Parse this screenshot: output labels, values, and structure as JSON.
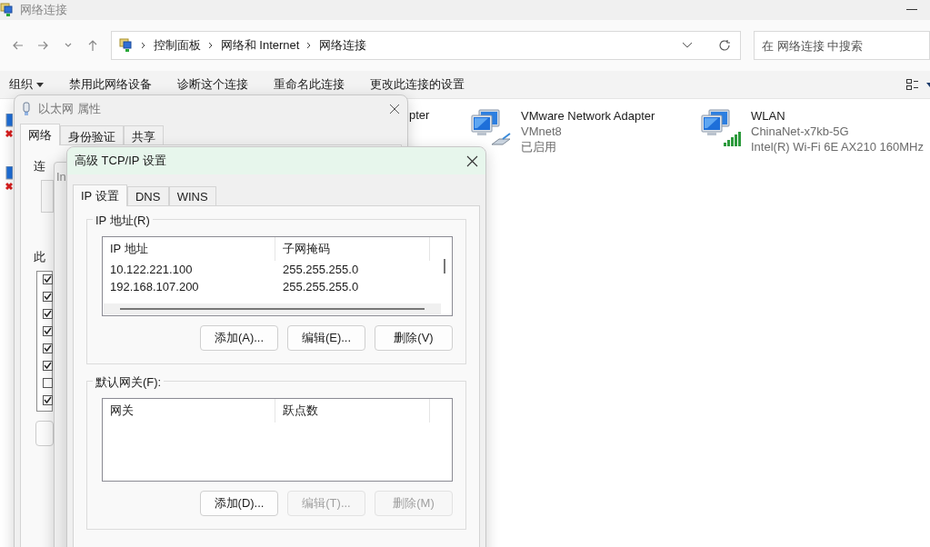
{
  "explorer": {
    "title": "网络连接",
    "breadcrumb": [
      "控制面板",
      "网络和 Internet",
      "网络连接"
    ],
    "search": {
      "placeholder": "在 网络连接 中搜索"
    },
    "toolbar": [
      {
        "label": "组织",
        "kind": "menu"
      },
      {
        "label": "禁用此网络设备",
        "kind": "command"
      },
      {
        "label": "诊断这个连接",
        "kind": "command"
      },
      {
        "label": "重命名此连接",
        "kind": "command"
      },
      {
        "label": "更改此连接的设置",
        "kind": "command"
      }
    ],
    "hidden_adapter_fragment": "pter",
    "adapters": [
      {
        "kind": "wired",
        "name": "VMware Network Adapter",
        "lines": [
          "VMnet8",
          "已启用"
        ]
      },
      {
        "kind": "wireless",
        "name": "WLAN",
        "lines": [
          "ChinaNet-x7kb-5G",
          "Intel(R) Wi-Fi 6E AX210 160MHz"
        ]
      }
    ]
  },
  "properties_dialog": {
    "title": "以太网 属性",
    "tabs": [
      {
        "label": "网络",
        "selected": true
      },
      {
        "label": "身份验证",
        "selected": false
      },
      {
        "label": "共享",
        "selected": false
      }
    ],
    "connect_label_fragment": "连",
    "items_label_fragment": "此",
    "components": [
      {
        "checked": true
      },
      {
        "checked": true
      },
      {
        "checked": true
      },
      {
        "checked": true
      },
      {
        "checked": true
      },
      {
        "checked": true
      },
      {
        "checked": false
      },
      {
        "checked": true
      }
    ]
  },
  "ipv4_dialog": {
    "title_fragment": "In"
  },
  "tcpip_dialog": {
    "title": "高级 TCP/IP 设置",
    "tabs": [
      {
        "label": "IP 设置",
        "selected": true
      },
      {
        "label": "DNS",
        "selected": false
      },
      {
        "label": "WINS",
        "selected": false
      }
    ],
    "ip_group": {
      "label": "IP 地址(R)",
      "columns": [
        "IP 地址",
        "子网掩码"
      ],
      "rows": [
        [
          "10.122.221.100",
          "255.255.255.0"
        ],
        [
          "192.168.107.200",
          "255.255.255.0"
        ]
      ],
      "buttons": [
        {
          "label": "添加(A)...",
          "disabled": false
        },
        {
          "label": "编辑(E)...",
          "disabled": false
        },
        {
          "label": "删除(V)",
          "disabled": false
        }
      ]
    },
    "gateway_group": {
      "label": "默认网关(F):",
      "columns": [
        "网关",
        "跃点数"
      ],
      "buttons": [
        {
          "label": "添加(D)...",
          "disabled": false
        },
        {
          "label": "编辑(T)...",
          "disabled": true
        },
        {
          "label": "删除(M)",
          "disabled": true
        }
      ]
    }
  }
}
